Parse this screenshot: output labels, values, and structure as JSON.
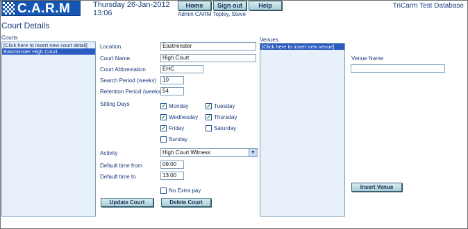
{
  "app": {
    "logo_text": "C.A.R.M",
    "date": "Thursday 26-Jan-2012",
    "time": "13:06",
    "user": "Admin CARM Topley, Steve",
    "database": "TriCarm Test Database"
  },
  "nav": {
    "home": "Home",
    "sign_out": "Sign out",
    "help": "Help"
  },
  "page": {
    "title": "Court Details"
  },
  "courts": {
    "label": "Courts",
    "items": [
      "[Click here to insert new court detail]",
      "Eastminster High Court"
    ],
    "selected_index": 1
  },
  "form": {
    "location": {
      "label": "Location",
      "value": "Eastminster"
    },
    "court_name": {
      "label": "Court Name",
      "value": "High Court"
    },
    "abbreviation": {
      "label": "Court Abbreviation",
      "value": "EHC"
    },
    "search_period": {
      "label": "Search Period (weeks)",
      "value": "10"
    },
    "retention_period": {
      "label": "Retention Period (weeks)",
      "value": "54"
    },
    "sitting_days": {
      "label": "Sitting Days",
      "days": [
        {
          "name": "Monday",
          "checked": true
        },
        {
          "name": "Tuesday",
          "checked": true
        },
        {
          "name": "Wednesday",
          "checked": true
        },
        {
          "name": "Thursday",
          "checked": true
        },
        {
          "name": "Friday",
          "checked": true
        },
        {
          "name": "Saturday",
          "checked": false
        },
        {
          "name": "Sunday",
          "checked": false
        }
      ]
    },
    "activity": {
      "label": "Activity",
      "value": "High Court Witness"
    },
    "time_from": {
      "label": "Default time from",
      "value": "09:00"
    },
    "time_to": {
      "label": "Default time to",
      "value": "13:00"
    },
    "no_extra_pay": {
      "label": "No Extra pay",
      "checked": false
    },
    "update_button": "Update Court",
    "delete_button": "Delete Court"
  },
  "venues": {
    "label": "Venues",
    "items": [
      "[Click here to insert new venue]"
    ],
    "selected_index": 0,
    "venue_name_label": "Venue Name",
    "venue_name_value": "",
    "insert_button": "Insert Venue"
  }
}
